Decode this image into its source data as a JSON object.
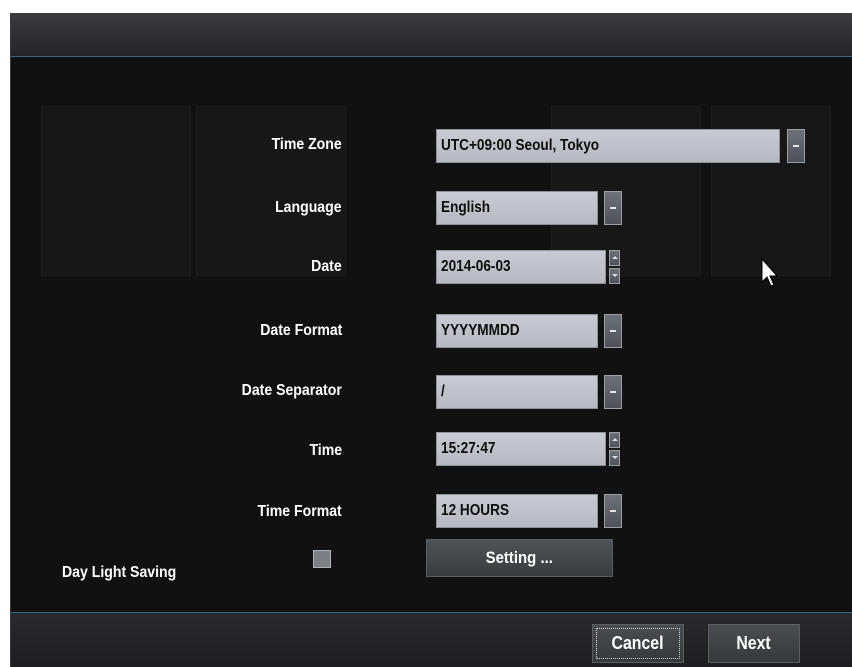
{
  "dialog": {
    "fields": {
      "time_zone": {
        "label": "Time Zone",
        "value": "UTC+09:00 Seoul, Tokyo"
      },
      "language": {
        "label": "Language",
        "value": "English"
      },
      "date": {
        "label": "Date",
        "value": "2014-06-03"
      },
      "date_format": {
        "label": "Date Format",
        "value": "YYYYMMDD"
      },
      "date_separator": {
        "label": "Date Separator",
        "value": "/"
      },
      "time": {
        "label": "Time",
        "value": "15:27:47"
      },
      "time_format": {
        "label": "Time Format",
        "value": "12 HOURS"
      }
    },
    "day_light_saving": {
      "label": "Day Light Saving",
      "checked": false
    },
    "setting_button": "Setting ...",
    "footer": {
      "cancel_label": "Cancel",
      "next_label": "Next"
    }
  }
}
